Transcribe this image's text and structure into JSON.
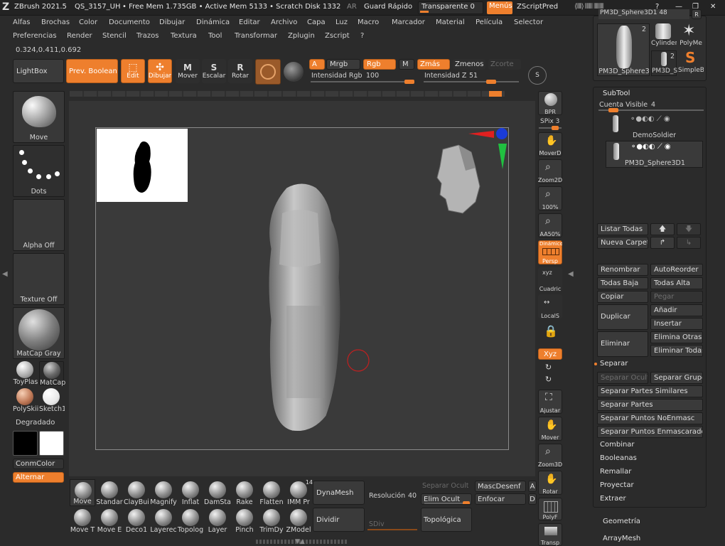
{
  "titlebar": {
    "app": "ZBrush 2021.5",
    "doc": "QS_3157_UH",
    "mem": "• Free Mem 1.735GB • Active Mem 5133 • Scratch Disk 1332 •",
    "ar": "AR",
    "quicksave": "Guard Rápido",
    "transparency": "Transparente 0",
    "menus": "Menús",
    "defaultscript": "ZScriptPred"
  },
  "menu": {
    "row1": [
      "Alfas",
      "Brochas",
      "Color",
      "Documento",
      "Dibujar",
      "Dinámica",
      "Editar",
      "Archivo",
      "Capa",
      "Luz",
      "Macro",
      "Marcador",
      "Material",
      "Película",
      "Selector"
    ],
    "row2": [
      "Preferencias",
      "Render",
      "Stencil",
      "Trazos",
      "Textura",
      "Tool",
      "Transformar",
      "Zplugin",
      "Zscript",
      "?"
    ]
  },
  "coords": "0.324,0.411,0.692",
  "shelf": {
    "lightbox": "LightBox",
    "preview_boolean": "Prev. Booleana",
    "edit": "Edit",
    "draw": "Dibujar",
    "move": "Mover",
    "scale": "Escalar",
    "rotate": "Rotar",
    "a": "A",
    "mrgb": "Mrgb",
    "rgb": "Rgb",
    "m": "M",
    "zadd": "Zmás",
    "zsub": "Zmenos",
    "zcut": "Zcorte",
    "rgb_intensity_label": "Intensidad Rgb",
    "rgb_intensity": "100",
    "z_intensity_label": "Intensidad Z",
    "z_intensity": "51",
    "s_label": "S"
  },
  "left": {
    "brush": "Move",
    "stroke": "Dots",
    "alpha": "Alpha Off",
    "texture": "Texture Off",
    "material": "MatCap Gray",
    "mats": [
      "ToyPlas",
      "MatCap",
      "PolySkii",
      "Sketch1"
    ],
    "gradient": "Degradado",
    "switchcolor": "ConmColor",
    "alternate": "Alternar"
  },
  "rightshelf": {
    "bpr": "BPR",
    "spix": "SPix 3",
    "items": [
      "MoverD",
      "Zoom2D",
      "100%",
      "AA50%",
      "Persp",
      "Cuadric",
      "LocalS",
      "Xyz",
      "Ajustar",
      "Mover",
      "Zoom3D",
      "Rotar",
      "PolyF",
      "Transp"
    ],
    "dynamic": "Dinámico"
  },
  "bottom": {
    "brushes_row1": [
      "Move",
      "Standar",
      "ClayBui",
      "Magnify",
      "Inflat",
      "DamSta",
      "Rake",
      "Flatten",
      "IMM Pr"
    ],
    "brushes_row2": [
      "Move T",
      "Move E",
      "Deco1",
      "Layerec",
      "Topolog",
      "Layer",
      "Pinch",
      "TrimDy",
      "ZModel"
    ],
    "imm_count": "14",
    "dynamesh": "DynaMesh",
    "divide": "Dividir",
    "resolution_label": "Resolución",
    "resolution": "40",
    "sdiv": "SDiv",
    "split_hidden": "Separar Ocult",
    "del_hidden": "Elim Ocult",
    "topology": "Topológica",
    "mask_blur": "MascDesenf",
    "sharpen": "Enfocar",
    "a_btn": "A",
    "d_btn": "D"
  },
  "tool": {
    "current": "PM3D_Sphere3D1",
    "current_count": "48",
    "thumbs": [
      {
        "name": "PM3D_Sphere3",
        "count": "2"
      },
      {
        "name": "Cylinder",
        "count": ""
      },
      {
        "name": "PolyMe",
        "count": ""
      },
      {
        "name": "PM3D_S",
        "count": "2"
      },
      {
        "name": "SimpleB",
        "count": ""
      }
    ],
    "r_btn": "R"
  },
  "subtool": {
    "title": "SubTool",
    "visible_label": "Cuenta Visible",
    "visible": "4",
    "items": [
      "DemoSoldier",
      "PM3D_Sphere3D1"
    ],
    "list_all": "Listar Todas",
    "new_folder": "Nueva Carpeta",
    "rename": "Renombrar",
    "autoreorder": "AutoReorder",
    "all_low": "Todas Baja",
    "all_high": "Todas Alta",
    "copy": "Copiar",
    "paste": "Pegar",
    "duplicate": "Duplicar",
    "append": "Añadir",
    "insert": "Insertar",
    "delete": "Eliminar",
    "delete_other": "Elimina Otras",
    "delete_all": "Eliminar Todas",
    "split": "Separar",
    "split_hidden": "Separar Ocult",
    "split_groups": "Separar Grupo",
    "split_similar": "Separar Partes Similares",
    "split_parts": "Separar Partes",
    "split_unmasked": "Separar Puntos NoEnmasc",
    "split_masked": "Separar Puntos Enmascarados",
    "sections": [
      "Combinar",
      "Booleanas",
      "Remallar",
      "Proyectar",
      "Extraer"
    ],
    "geometry": "Geometría",
    "arraymesh": "ArrayMesh"
  },
  "colors": {
    "accent": "#ee7f2d",
    "panel": "#2b2b2b",
    "canvas": "#3a3a3a"
  }
}
